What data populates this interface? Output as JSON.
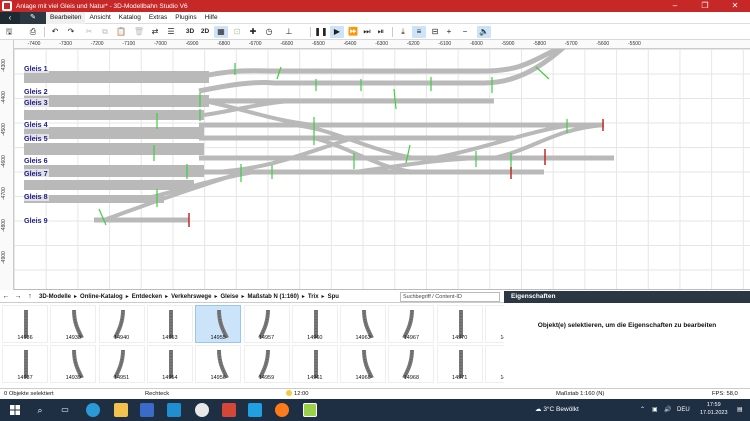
{
  "titlebar": {
    "title": "Anlage mit viel Gleis und Natur* - 3D-Modellbahn Studio V6",
    "minimize": "–",
    "maximize": "❐",
    "close": "✕"
  },
  "menubar": {
    "back": "‹",
    "edit_tab": "✎",
    "items": [
      "Bearbeiten",
      "Ansicht",
      "Katalog",
      "Extras",
      "Plugins",
      "Hilfe"
    ]
  },
  "toolbar": {
    "view_2d": "2D",
    "view_3d": "3D"
  },
  "ruler": {
    "x_ticks": [
      "-7400",
      "-7300",
      "-7200",
      "-7100",
      "-7000",
      "-6900",
      "-6800",
      "-6700",
      "-6600",
      "-6500",
      "-6400",
      "-6300",
      "-6200",
      "-6100",
      "-6000",
      "-5900",
      "-5800",
      "-5700",
      "-5600",
      "-5500"
    ],
    "y_ticks": [
      "-4300",
      "-4400",
      "-4500",
      "-4600",
      "-4700",
      "-4800",
      "-4900"
    ]
  },
  "tracks": {
    "labels": [
      "Gleis 1",
      "Gleis 2",
      "Gleis 3",
      "Gleis 4",
      "Gleis 5",
      "Gleis 6",
      "Gleis 7",
      "Gleis 8",
      "Gleis 9"
    ]
  },
  "catalog": {
    "breadcrumb": [
      "3D-Modelle",
      "Online-Katalog",
      "Entdecken",
      "Verkehrswege",
      "Gleise",
      "Maßstab N (1:160)",
      "Trix",
      "Spu"
    ],
    "search_placeholder": "Suchbegriff / Content-ID",
    "items_row1": [
      "14936",
      "14938",
      "14940",
      "14953",
      "14955",
      "14957",
      "14960",
      "14963",
      "14967",
      "14970",
      "14972"
    ],
    "items_row2": [
      "14937",
      "14939",
      "14951",
      "14954",
      "14956",
      "14959",
      "14961",
      "14966",
      "14968",
      "14971",
      "14973"
    ],
    "selected_item": "14955"
  },
  "properties": {
    "header": "Eigenschaften",
    "message": "Objekt(e) selektieren, um die Eigenschaften zu bearbeiten"
  },
  "statusbar": {
    "selection": "0 Objekte selektiert",
    "tool": "Rechteck",
    "time": "12:00",
    "scale": "Maßstab 1:160 (N)",
    "fps": "FPS: 58,0"
  },
  "taskbar": {
    "weather_temp": "3°C",
    "weather_text": "Bewölkt",
    "language": "DEU",
    "clock_time": "17:59",
    "clock_date": "17.01.2023"
  },
  "colors": {
    "title_red": "#c62828",
    "track_gray": "#b8b8b8",
    "sleeper_green": "#3fcf3f",
    "label_blue": "#1a1a8c",
    "taskbar": "#1e2f44"
  }
}
